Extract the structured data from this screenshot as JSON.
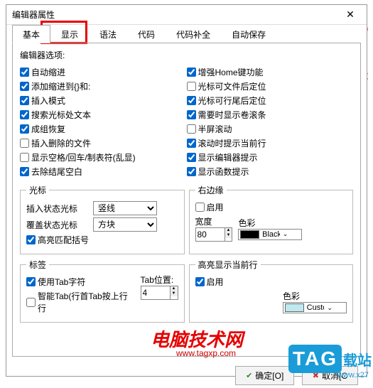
{
  "dialog": {
    "title": "编辑器属性"
  },
  "tabs": {
    "t0": "基本",
    "t1": "显示",
    "t2": "语法",
    "t3": "代码",
    "t4": "代码补全",
    "t5": "自动保存",
    "active": 0
  },
  "section_label": "编辑器选项:",
  "left_checks": [
    {
      "label": "自动缩进",
      "checked": true
    },
    {
      "label": "添加缩进到{}和:",
      "checked": true
    },
    {
      "label": "插入模式",
      "checked": true
    },
    {
      "label": "搜索光标处文本",
      "checked": true
    },
    {
      "label": "成组恢复",
      "checked": true
    },
    {
      "label": "插入删除的文件",
      "checked": false
    },
    {
      "label": "显示空格/回车/制表符(乱显)",
      "checked": false
    },
    {
      "label": "去除结尾空白",
      "checked": true
    }
  ],
  "right_checks": [
    {
      "label": "增强Home键功能",
      "checked": true
    },
    {
      "label": "光标可文件后定位",
      "checked": false
    },
    {
      "label": "光标可行尾后定位",
      "checked": true
    },
    {
      "label": "需要时显示卷滚条",
      "checked": true
    },
    {
      "label": "半屏滚动",
      "checked": false
    },
    {
      "label": "滚动时提示当前行",
      "checked": true
    },
    {
      "label": "显示编辑器提示",
      "checked": true
    },
    {
      "label": "显示函数提示",
      "checked": true
    }
  ],
  "cursor": {
    "legend": "光标",
    "insert_label": "插入状态光标",
    "insert_val": "竖线",
    "over_label": "覆盖状态光标",
    "over_val": "方块",
    "highlight_brace": {
      "label": "高亮匹配括号",
      "checked": true
    }
  },
  "margin": {
    "legend": "右边缘",
    "enable": {
      "label": "启用",
      "checked": false
    },
    "width_label": "宽度",
    "width_val": "80",
    "color_label": "色彩",
    "color_name": "Black",
    "color_hex": "#000000"
  },
  "tabchars": {
    "legend": "标签",
    "use_tab": {
      "label": "使用Tab字符",
      "checked": true
    },
    "smart": {
      "label": "智能Tab(行首Tab按上行行",
      "checked": false
    },
    "pos_label": "Tab位置:",
    "pos_val": "4"
  },
  "hl_line": {
    "legend": "高亮显示当前行",
    "enable": {
      "label": "启用",
      "checked": true
    },
    "color_label": "色彩",
    "color_name": "Custom...",
    "color_hex": "#bfe8ef"
  },
  "buttons": {
    "ok": "确定[O]",
    "cancel": "取消[C"
  },
  "watermark": {
    "text": "电脑技术网",
    "url": "www.tagxp.com",
    "tag": "TAG",
    "tag2": "载站",
    "tag_url": "www.x27"
  }
}
